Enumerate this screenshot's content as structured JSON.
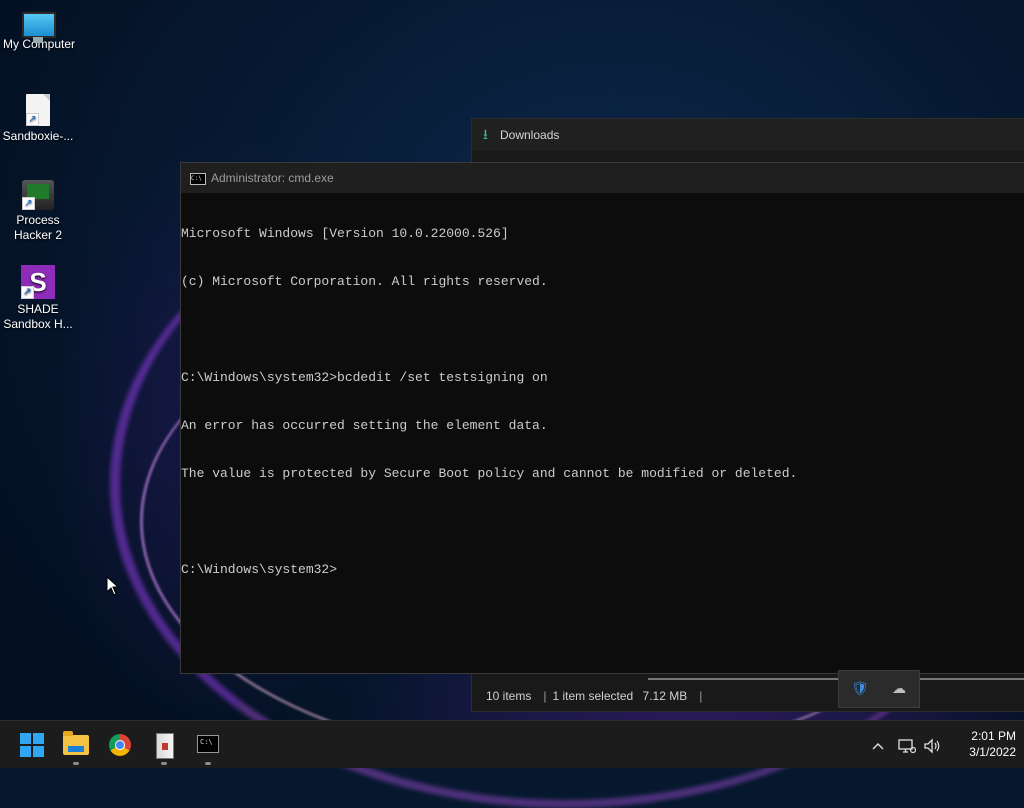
{
  "desktop": {
    "icons": [
      {
        "label_line1": "My Computer",
        "label_line2": ""
      },
      {
        "label_line1": "Sandboxie-...",
        "label_line2": ""
      },
      {
        "label_line1": "Process",
        "label_line2": "Hacker 2"
      },
      {
        "label_line1": "SHADE",
        "label_line2": "Sandbox H..."
      }
    ]
  },
  "downloads_window": {
    "title": "Downloads",
    "status": {
      "items": "10 items",
      "selected": "1 item selected",
      "size": "7.12 MB"
    }
  },
  "cmd_window": {
    "title": "Administrator: cmd.exe",
    "lines": [
      "Microsoft Windows [Version 10.0.22000.526]",
      "(c) Microsoft Corporation. All rights reserved.",
      "",
      "C:\\Windows\\system32>bcdedit /set testsigning on",
      "An error has occurred setting the element data.",
      "The value is protected by Secure Boot policy and cannot be modified or deleted.",
      "",
      "C:\\Windows\\system32>"
    ]
  },
  "taskbar": {
    "apps": [
      "start-icon",
      "file-explorer-icon",
      "chrome-icon",
      "archive-icon",
      "terminal-icon"
    ],
    "tray": {
      "chevron": "^"
    },
    "clock": {
      "time": "2:01 PM",
      "date": "3/1/2022"
    }
  },
  "colors": {
    "accent": "#2ea6f3",
    "console_bg": "#0c0c0c",
    "console_text": "#cccccc",
    "download_icon": "#3bbf7a"
  }
}
